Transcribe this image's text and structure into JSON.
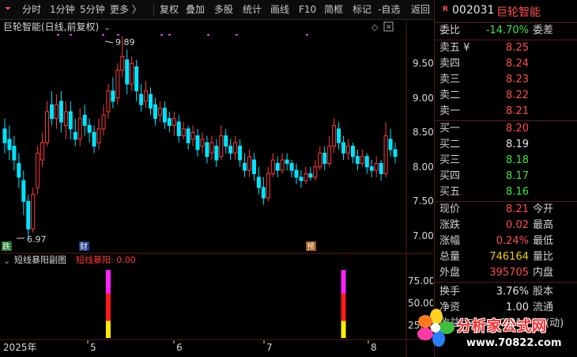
{
  "toolbar": {
    "items": [
      "分时",
      "1分钟",
      "5分钟",
      "更多 〉",
      "复权",
      "叠加",
      "多股",
      "统计",
      "画线",
      "F10",
      "简框",
      "标记",
      "-自选",
      "返回"
    ]
  },
  "chart": {
    "title": "巨轮智能(日线,前复权)",
    "price_axis": [
      "9.50",
      "9.00",
      "8.50",
      "8.00",
      "7.50",
      "7.00"
    ],
    "high_label": "9.89",
    "low_label": "6.97",
    "markers": {
      "die": "跌",
      "cai": "财",
      "yu": "预"
    },
    "sub_title": "短线暴阳副图",
    "sub_value": "短线暴阳: 0.00",
    "sub_axis": [
      "75.00",
      "50.00",
      "25.00"
    ],
    "date_axis": [
      "2025年",
      "5",
      "6",
      "7",
      "8"
    ],
    "colors": {
      "up": "#ff3b3b",
      "down": "#00e5ff",
      "bg": "#000000"
    }
  },
  "chart_data": {
    "type": "candlestick",
    "symbol": "002031",
    "name": "巨轮智能",
    "ylim": [
      6.85,
      10.0
    ],
    "high": 9.89,
    "low": 6.97,
    "candles": [
      [
        8.55,
        8.35,
        8.7,
        8.2
      ],
      [
        8.4,
        8.25,
        8.6,
        8.1
      ],
      [
        8.3,
        8.1,
        8.45,
        7.95
      ],
      [
        8.05,
        7.85,
        8.2,
        7.7
      ],
      [
        7.8,
        7.5,
        7.95,
        7.3
      ],
      [
        7.5,
        7.1,
        7.6,
        6.97
      ],
      [
        7.1,
        7.6,
        7.7,
        7.05
      ],
      [
        7.7,
        8.2,
        8.3,
        7.6
      ],
      [
        8.1,
        8.35,
        8.5,
        8.0
      ],
      [
        8.35,
        8.8,
        8.95,
        8.3
      ],
      [
        8.9,
        8.7,
        9.1,
        8.6
      ],
      [
        8.7,
        8.9,
        9.05,
        8.55
      ],
      [
        8.95,
        8.65,
        9.1,
        8.5
      ],
      [
        8.6,
        8.8,
        8.95,
        8.4
      ],
      [
        8.8,
        8.55,
        8.95,
        8.4
      ],
      [
        8.5,
        8.4,
        8.7,
        8.3
      ],
      [
        8.4,
        8.7,
        8.85,
        8.3
      ],
      [
        8.75,
        8.6,
        8.9,
        8.45
      ],
      [
        8.6,
        8.5,
        8.7,
        8.35
      ],
      [
        8.5,
        8.3,
        8.6,
        8.2
      ],
      [
        8.35,
        8.55,
        8.7,
        8.25
      ],
      [
        8.55,
        8.75,
        8.9,
        8.45
      ],
      [
        8.8,
        9.1,
        9.2,
        8.7
      ],
      [
        9.1,
        8.95,
        9.3,
        8.85
      ],
      [
        9.0,
        9.4,
        9.5,
        8.9
      ],
      [
        9.4,
        9.6,
        9.89,
        9.3
      ],
      [
        9.55,
        9.2,
        9.7,
        9.05
      ],
      [
        9.2,
        9.5,
        9.6,
        9.1
      ],
      [
        9.45,
        9.1,
        9.55,
        8.95
      ],
      [
        9.05,
        8.9,
        9.2,
        8.8
      ],
      [
        8.95,
        9.1,
        9.25,
        8.85
      ],
      [
        9.05,
        8.85,
        9.15,
        8.75
      ],
      [
        8.9,
        8.7,
        9.0,
        8.6
      ],
      [
        8.75,
        8.85,
        8.95,
        8.65
      ],
      [
        8.85,
        8.65,
        8.95,
        8.55
      ],
      [
        8.7,
        8.6,
        8.8,
        8.5
      ],
      [
        8.6,
        8.7,
        8.8,
        8.45
      ],
      [
        8.65,
        8.45,
        8.75,
        8.35
      ],
      [
        8.45,
        8.55,
        8.65,
        8.4
      ],
      [
        8.55,
        8.35,
        8.6,
        8.25
      ],
      [
        8.4,
        8.5,
        8.6,
        8.3
      ],
      [
        8.45,
        8.25,
        8.55,
        8.15
      ],
      [
        8.3,
        8.4,
        8.5,
        8.2
      ],
      [
        8.35,
        8.15,
        8.45,
        8.05
      ],
      [
        8.2,
        8.35,
        8.45,
        8.1
      ],
      [
        8.3,
        8.1,
        8.4,
        8.0
      ],
      [
        8.15,
        8.45,
        8.6,
        8.1
      ],
      [
        8.45,
        8.3,
        8.55,
        8.2
      ],
      [
        8.3,
        8.2,
        8.4,
        8.1
      ],
      [
        8.2,
        8.35,
        8.45,
        8.1
      ],
      [
        8.3,
        8.1,
        8.4,
        8.0
      ],
      [
        8.05,
        7.95,
        8.2,
        7.85
      ],
      [
        7.95,
        8.15,
        8.25,
        7.85
      ],
      [
        8.1,
        7.9,
        8.2,
        7.8
      ],
      [
        7.85,
        7.7,
        8.0,
        7.6
      ],
      [
        7.7,
        7.55,
        7.85,
        7.45
      ],
      [
        7.55,
        7.9,
        8.0,
        7.5
      ],
      [
        7.9,
        8.1,
        8.2,
        7.85
      ],
      [
        8.05,
        7.95,
        8.15,
        7.85
      ],
      [
        7.95,
        8.1,
        8.2,
        7.9
      ],
      [
        8.1,
        8.05,
        8.2,
        7.95
      ],
      [
        8.05,
        7.95,
        8.1,
        7.85
      ],
      [
        7.95,
        7.85,
        8.05,
        7.75
      ],
      [
        7.85,
        7.8,
        7.95,
        7.7
      ],
      [
        7.8,
        7.9,
        8.0,
        7.75
      ],
      [
        7.9,
        7.85,
        8.0,
        7.8
      ],
      [
        7.85,
        8.0,
        8.1,
        7.8
      ],
      [
        8.0,
        8.2,
        8.3,
        7.95
      ],
      [
        8.2,
        8.05,
        8.3,
        7.95
      ],
      [
        8.05,
        8.3,
        8.45,
        8.0
      ],
      [
        8.3,
        8.6,
        8.7,
        8.2
      ],
      [
        8.55,
        8.35,
        8.65,
        8.25
      ],
      [
        8.35,
        8.2,
        8.45,
        8.1
      ],
      [
        8.2,
        8.3,
        8.4,
        8.1
      ],
      [
        8.3,
        8.15,
        8.35,
        8.05
      ],
      [
        8.15,
        8.05,
        8.25,
        7.95
      ],
      [
        8.05,
        8.15,
        8.25,
        8.0
      ],
      [
        8.15,
        8.0,
        8.2,
        7.9
      ],
      [
        8.0,
        7.95,
        8.1,
        7.85
      ],
      [
        7.95,
        8.05,
        8.15,
        7.85
      ],
      [
        8.05,
        7.9,
        8.1,
        7.8
      ],
      [
        7.9,
        8.45,
        8.65,
        7.85
      ],
      [
        8.4,
        8.25,
        8.55,
        8.15
      ],
      [
        8.25,
        8.15,
        8.35,
        8.05
      ]
    ],
    "sub_series": {
      "name": "短线暴阳",
      "signals": [
        {
          "index": 22,
          "value": 100
        },
        {
          "index": 72,
          "value": 100
        }
      ]
    }
  },
  "quote": {
    "badge": "R",
    "code": "002031",
    "name": "巨轮智能",
    "weibi_label": "委比",
    "weibi_value": "-14.70%",
    "weicha_label": "委差",
    "sell": [
      {
        "label": "卖五 ¥",
        "price": "8.25"
      },
      {
        "label": "卖四",
        "price": "8.24"
      },
      {
        "label": "卖三",
        "price": "8.23"
      },
      {
        "label": "卖二",
        "price": "8.22"
      },
      {
        "label": "卖一",
        "price": "8.21"
      }
    ],
    "buy": [
      {
        "label": "买一",
        "price": "8.20"
      },
      {
        "label": "买二",
        "price": "8.19"
      },
      {
        "label": "买三",
        "price": "8.18"
      },
      {
        "label": "买四",
        "price": "8.17"
      },
      {
        "label": "买五",
        "price": "8.16"
      }
    ],
    "stats": [
      {
        "label": "现价",
        "value": "8.21",
        "label2": "今开"
      },
      {
        "label": "涨跌",
        "value": "0.02",
        "label2": "最高"
      },
      {
        "label": "涨幅",
        "value": "0.24%",
        "label2": "最低"
      },
      {
        "label": "总量",
        "value": "746164",
        "label2": "量比"
      },
      {
        "label": "外盘",
        "value": "395705",
        "label2": "内盘"
      }
    ],
    "stats2": [
      {
        "label": "换手",
        "value": "3.76%",
        "label2": "股本"
      },
      {
        "label": "净资",
        "value": "1.00",
        "label2": "流通"
      },
      {
        "label": "收益(二)",
        "value": "-0.010",
        "label2": "PE(动)"
      }
    ]
  },
  "watermark": {
    "text": "分析家公式网",
    "url": "www.70822.com"
  }
}
